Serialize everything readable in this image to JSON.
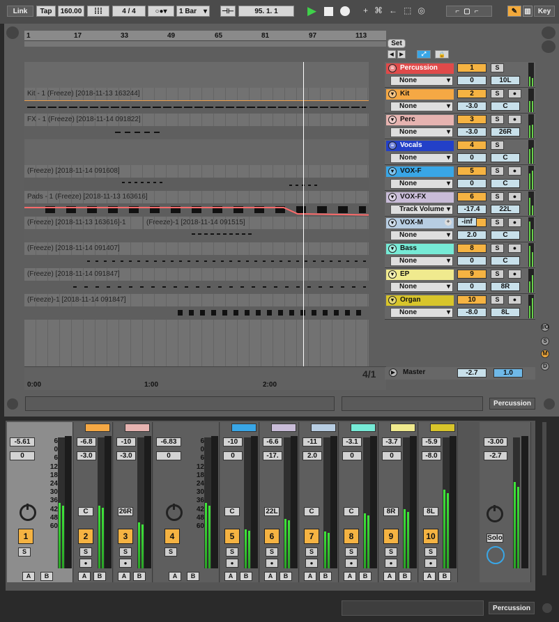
{
  "transport": {
    "link": "Link",
    "tap": "Tap",
    "tempo": "160.00",
    "time_sig_num": "4",
    "time_sig_den": "4",
    "quantize": "1 Bar",
    "position": "95.  1.  1",
    "key": "Key"
  },
  "ruler": {
    "bars": [
      "1",
      "17",
      "33",
      "49",
      "65",
      "81",
      "97",
      "113"
    ],
    "times": [
      "0:00",
      "1:00",
      "2:00"
    ],
    "fraction": "4/1"
  },
  "clips": [
    {
      "name": "Kit - 1 (Freeze) [2018-11-13 163244]",
      "color": "#f0a04a"
    },
    {
      "name": "FX - 1 (Freeze) [2018-11-14 091822]",
      "color": "#d9b4b0"
    },
    {
      "name": "(Freeze) [2018-11-14 091608]",
      "color": "#3ea5e0"
    },
    {
      "name": "Pads - 1 (Freeze) [2018-11-13 163616]",
      "color": "#c0b5cf"
    },
    {
      "name": "(Freeze) [2018-11-13 163616]-1",
      "name2": "(Freeze)-1 [2018-11-14 091515]",
      "color": "#a9c5dc"
    },
    {
      "name": "(Freeze) [2018-11-14 091407]",
      "color": "#6fe0d0"
    },
    {
      "name": "(Freeze) [2018-11-14 091847]",
      "color": "#ece79a"
    },
    {
      "name": "(Freeze)-1 [2018-11-14 091847]",
      "color": "#d2c32e"
    }
  ],
  "set_label": "Set",
  "tracks": [
    {
      "name": "Percussion",
      "input": "None",
      "num": "1",
      "vol": "0",
      "pan": "10L",
      "color": "#e04a4a",
      "group": true
    },
    {
      "name": "Kit",
      "input": "None",
      "num": "2",
      "vol": "-3.0",
      "pan": "C",
      "color": "#f5a844",
      "group": false
    },
    {
      "name": "Perc",
      "input": "None",
      "num": "3",
      "vol": "-3.0",
      "pan": "26R",
      "color": "#e6b3b0",
      "group": false
    },
    {
      "name": "Vocals",
      "input": "None",
      "num": "4",
      "vol": "0",
      "pan": "C",
      "color": "#2340c8",
      "group": true
    },
    {
      "name": "VOX-F",
      "input": "None",
      "num": "5",
      "vol": "0",
      "pan": "C",
      "color": "#39a6e6",
      "group": false
    },
    {
      "name": "VOX-FX",
      "input": "Track Volume",
      "num": "6",
      "vol": "-17.4",
      "pan": "22L",
      "color": "#c9bcd8",
      "group": false,
      "extra": "-inf"
    },
    {
      "name": "VOX-M",
      "input": "None",
      "num": "7",
      "vol": "2.0",
      "pan": "C",
      "color": "#b7cde2",
      "group": false
    },
    {
      "name": "Bass",
      "input": "None",
      "num": "8",
      "vol": "0",
      "pan": "C",
      "color": "#76ead6",
      "group": false
    },
    {
      "name": "EP",
      "input": "None",
      "num": "9",
      "vol": "0",
      "pan": "8R",
      "color": "#f0ea8e",
      "group": false
    },
    {
      "name": "Organ",
      "input": "None",
      "num": "10",
      "vol": "-8.0",
      "pan": "8L",
      "color": "#d8c52b",
      "group": false
    }
  ],
  "master": {
    "name": "Master",
    "vol": "-2.7",
    "pan": "1.0"
  },
  "status": {
    "selected": "Percussion"
  },
  "mixer": [
    {
      "peak": "-5.61",
      "vol": "0",
      "pan": "",
      "num": "1",
      "meter": 0.5
    },
    {
      "peak": "-6.8",
      "vol": "-3.0",
      "pan": "C",
      "num": "2",
      "meter": 0.48
    },
    {
      "peak": "-10",
      "vol": "-3.0",
      "pan": "26R",
      "num": "3",
      "meter": 0.35
    },
    {
      "peak": "-6.83",
      "vol": "0",
      "pan": "",
      "num": "4",
      "meter": 0.5
    },
    {
      "peak": "-10",
      "vol": "0",
      "pan": "C",
      "num": "5",
      "meter": 0.3
    },
    {
      "peak": "-6.6",
      "vol": "-17.",
      "pan": "22L",
      "num": "6",
      "meter": 0.38
    },
    {
      "peak": "-11",
      "vol": "2.0",
      "pan": "C",
      "num": "7",
      "meter": 0.28
    },
    {
      "peak": "-3.1",
      "vol": "0",
      "pan": "C",
      "num": "8",
      "meter": 0.42
    },
    {
      "peak": "-3.7",
      "vol": "0",
      "pan": "8R",
      "num": "9",
      "meter": 0.45
    },
    {
      "peak": "-5.9",
      "vol": "-8.0",
      "pan": "8L",
      "num": "10",
      "meter": 0.6
    }
  ],
  "db_scale": [
    "6",
    "0",
    "6",
    "12",
    "18",
    "24",
    "30",
    "36",
    "42",
    "48",
    "60"
  ],
  "master_strip": {
    "peak": "-3.00",
    "vol": "-2.7",
    "solo": "Solo"
  },
  "ab": {
    "a": "A",
    "b": "B",
    "s": "S"
  },
  "io_toggles": [
    "I/O",
    "S",
    "R",
    "M",
    "D",
    "X"
  ]
}
